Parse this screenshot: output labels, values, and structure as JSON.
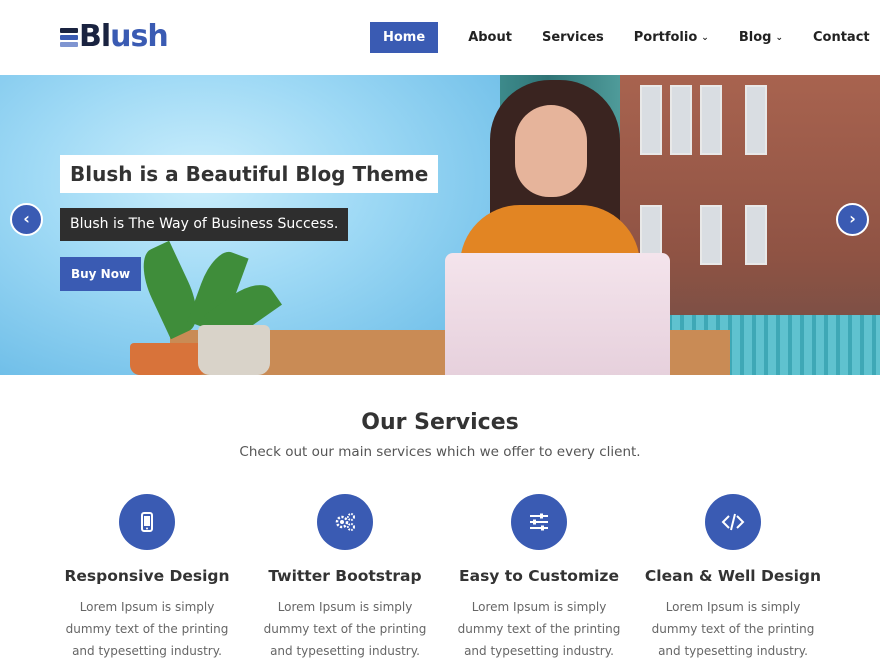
{
  "header": {
    "logo_part1": "Bl",
    "logo_part2": "ush",
    "nav": [
      {
        "label": "Home",
        "active": true
      },
      {
        "label": "About"
      },
      {
        "label": "Services"
      },
      {
        "label": "Portfolio",
        "dropdown": true
      },
      {
        "label": "Blog",
        "dropdown": true
      },
      {
        "label": "Contact"
      }
    ]
  },
  "hero": {
    "title": "Blush is a Beautiful Blog Theme",
    "subtitle": "Blush is The Way of Business Success.",
    "button": "Buy Now",
    "prev_icon": "chevron-left-icon",
    "next_icon": "chevron-right-icon"
  },
  "services": {
    "title": "Our Services",
    "subtitle": "Check out our main services which we offer to every client.",
    "items": [
      {
        "icon": "mobile-icon",
        "title": "Responsive Design",
        "text": "Lorem Ipsum is simply dummy text of the printing and typesetting industry."
      },
      {
        "icon": "gears-icon",
        "title": "Twitter Bootstrap",
        "text": "Lorem Ipsum is simply dummy text of the printing and typesetting industry."
      },
      {
        "icon": "sliders-icon",
        "title": "Easy to Customize",
        "text": "Lorem Ipsum is simply dummy text of the printing and typesetting industry."
      },
      {
        "icon": "code-icon",
        "title": "Clean & Well Design",
        "text": "Lorem Ipsum is simply dummy text of the printing and typesetting industry."
      }
    ]
  },
  "colors": {
    "accent": "#3a5bb3",
    "logo_dark": "#1a2340",
    "dark_label": "#2e2e2e"
  }
}
